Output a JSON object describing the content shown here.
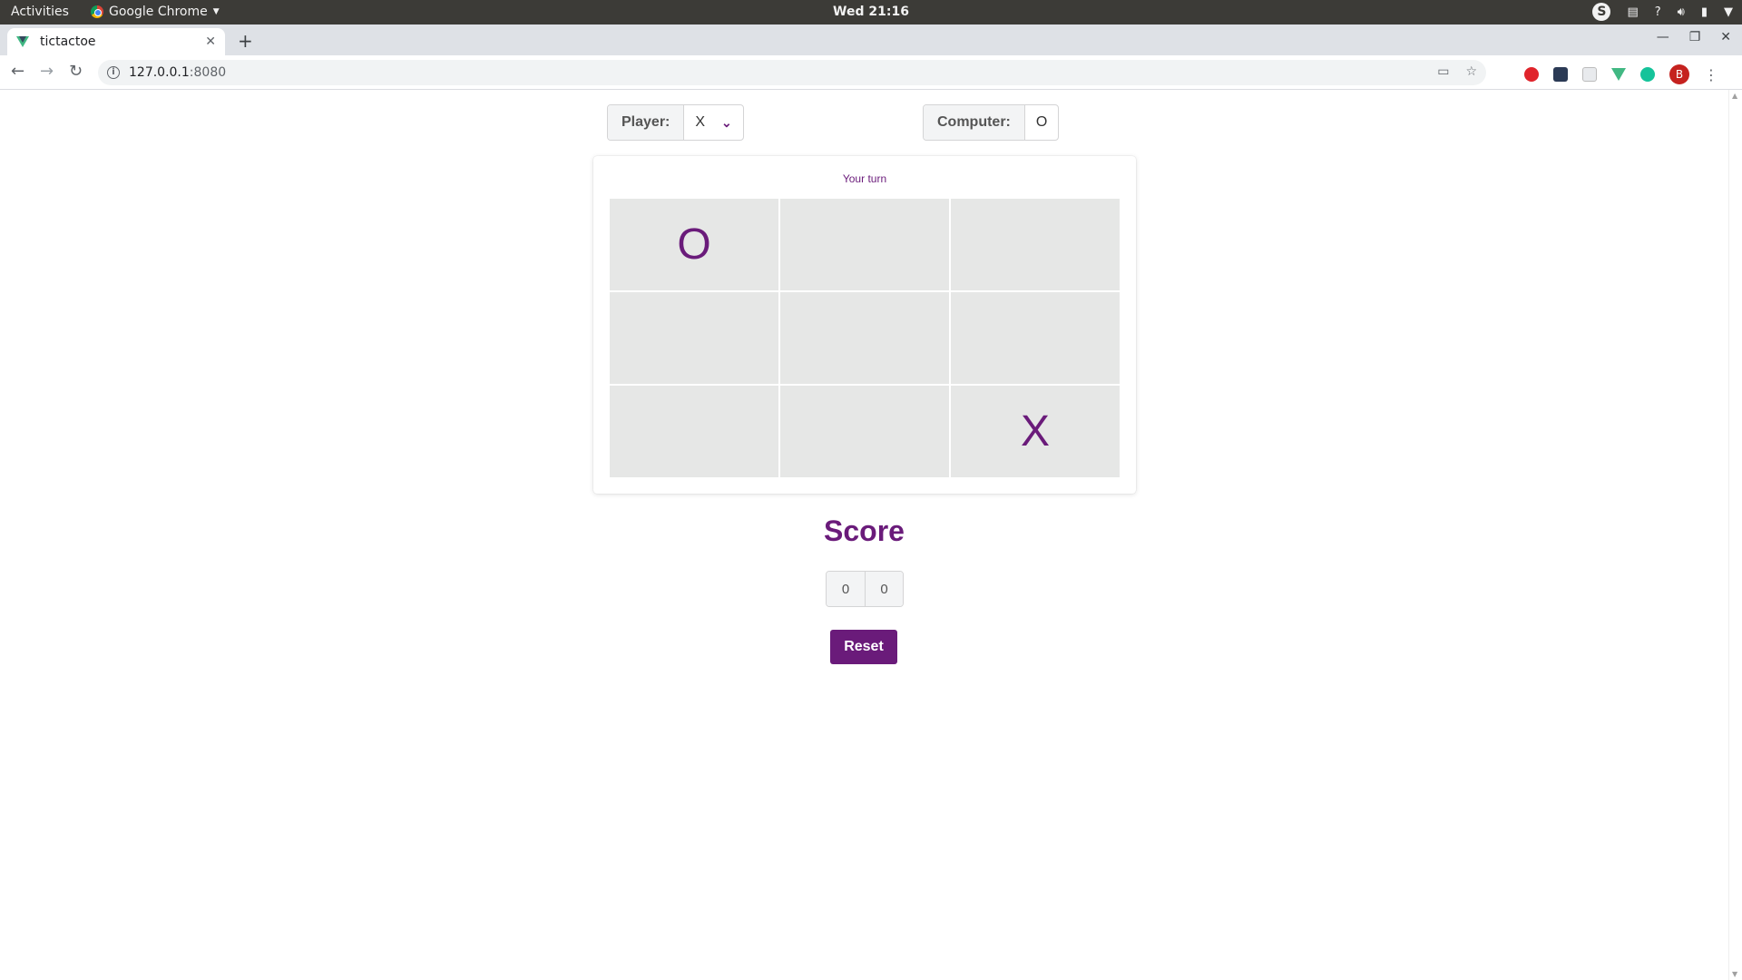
{
  "system": {
    "activities": "Activities",
    "app_name": "Google Chrome",
    "clock": "Wed 21:16"
  },
  "browser": {
    "tab_title": "tictactoe",
    "url_host": "127.0.0.1",
    "url_port": ":8080",
    "avatar_letter": "B"
  },
  "game": {
    "player_label": "Player:",
    "player_symbol": "X",
    "computer_label": "Computer:",
    "computer_symbol": "O",
    "status": "Your turn",
    "board": [
      "O",
      "",
      "",
      "",
      "",
      "",
      "",
      "",
      "X"
    ]
  },
  "score": {
    "title": "Score",
    "player": "0",
    "computer": "0"
  },
  "actions": {
    "reset_label": "Reset"
  },
  "colors": {
    "accent": "#6a1b7a",
    "cell_bg": "#e6e7e6"
  }
}
